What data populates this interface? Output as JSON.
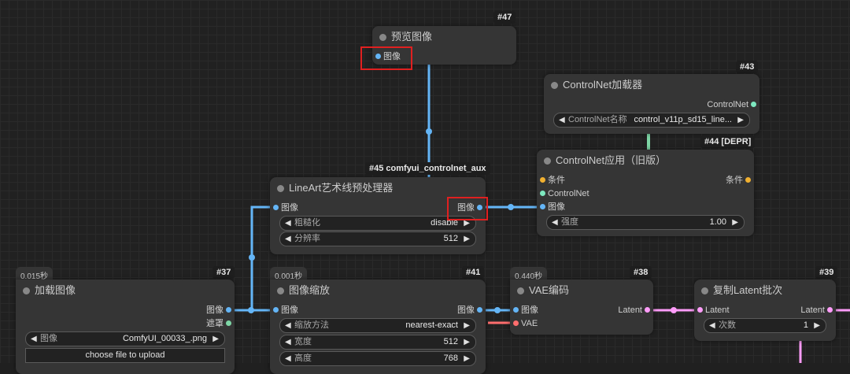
{
  "nodes": {
    "preview": {
      "id": "#47",
      "title": "预览图像",
      "input": "图像"
    },
    "controlnet_loader": {
      "id": "#43",
      "title": "ControlNet加载器",
      "output": "ControlNet",
      "widget": {
        "label": "ControlNet名称",
        "value": "control_v11p_sd15_line..."
      }
    },
    "controlnet_apply": {
      "id": "#44 [DEPR]",
      "title": "ControlNet应用（旧版）",
      "inputs": [
        "条件",
        "ControlNet",
        "图像"
      ],
      "output": "条件",
      "widget": {
        "label": "强度",
        "value": "1.00"
      }
    },
    "lineart": {
      "id": "#45 comfyui_controlnet_aux",
      "title": "LineArt艺术线预处理器",
      "input": "图像",
      "output": "图像",
      "widgets": [
        {
          "label": "粗糙化",
          "value": "disable"
        },
        {
          "label": "分辨率",
          "value": "512"
        }
      ]
    },
    "load_image": {
      "id": "#37",
      "time": "0.015秒",
      "title": "加载图像",
      "outputs": [
        "图像",
        "遮罩"
      ],
      "widget": {
        "label": "图像",
        "value": "ComfyUI_00033_.png"
      },
      "button": "choose file to upload"
    },
    "image_scale": {
      "id": "#41",
      "time": "0.001秒",
      "title": "图像缩放",
      "input": "图像",
      "output": "图像",
      "widgets": [
        {
          "label": "缩放方法",
          "value": "nearest-exact"
        },
        {
          "label": "宽度",
          "value": "512"
        },
        {
          "label": "高度",
          "value": "768"
        }
      ]
    },
    "vae_encode": {
      "id": "#38",
      "time": "0.440秒",
      "title": "VAE编码",
      "inputs": [
        "图像",
        "VAE"
      ],
      "output": "Latent"
    },
    "latent_batch": {
      "id": "#39",
      "title": "复制Latent批次",
      "input": "Latent",
      "output": "Latent",
      "widget": {
        "label": "次数",
        "value": "1"
      }
    }
  },
  "colors": {
    "image": "#64b5f6",
    "conditioning": "#f0b030",
    "controlnet": "#7ed6a6",
    "latent": "#ff9cf9",
    "vae": "#ff6e6e",
    "highlight": "#e02020"
  }
}
